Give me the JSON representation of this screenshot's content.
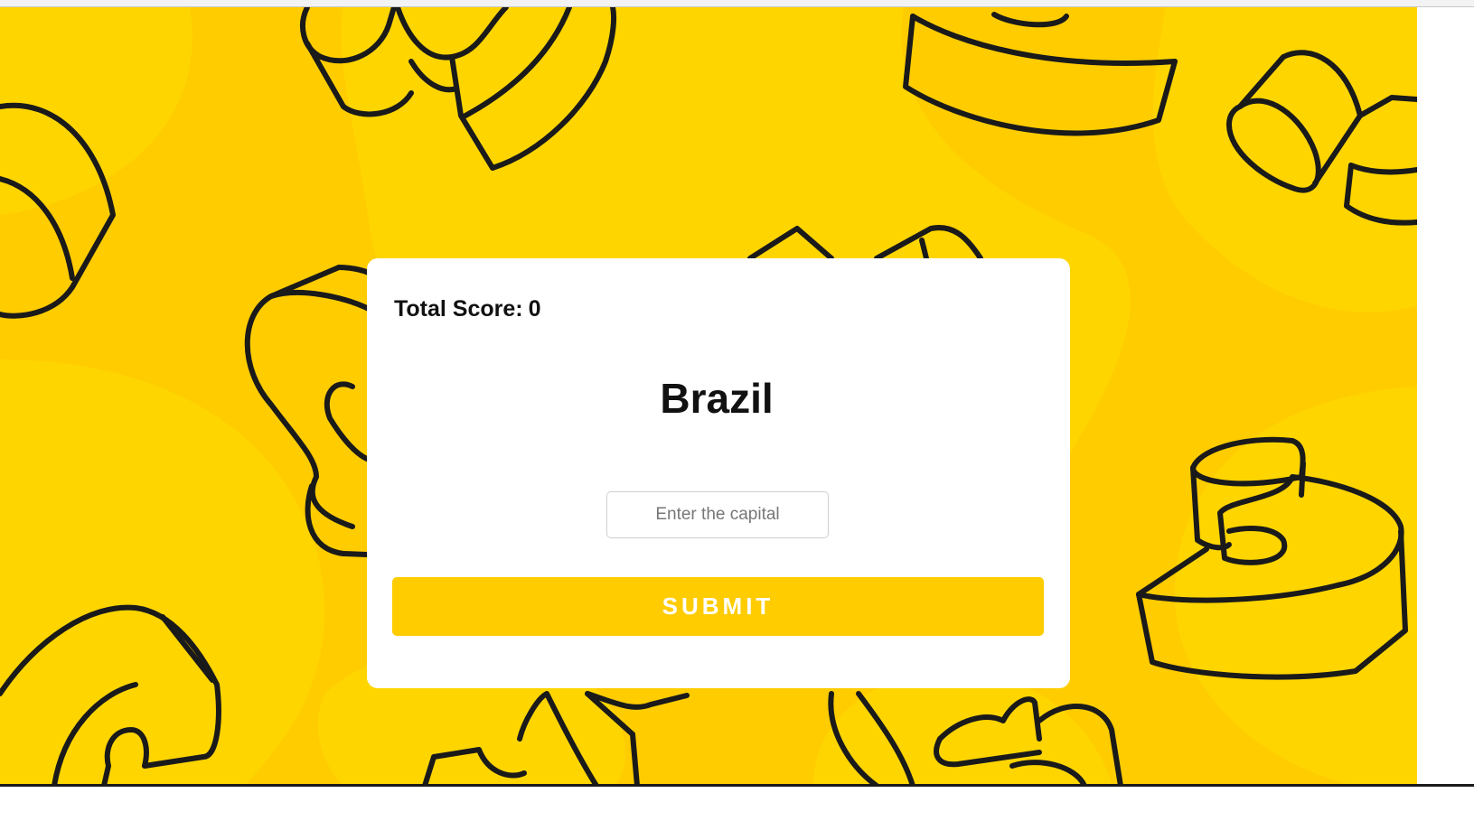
{
  "quiz": {
    "score_label": "Total Score:",
    "score_value": "0",
    "country": "Brazil",
    "capital_placeholder": "Enter the capital",
    "capital_value": "",
    "submit_label": "SUBMIT"
  },
  "theme": {
    "background": "#ffcc00",
    "background_light": "#ffd500",
    "card": "#ffffff",
    "accent": "#ffcc00",
    "outline": "#1a1a1a"
  },
  "icons": [
    "doodle-pattern-background"
  ]
}
